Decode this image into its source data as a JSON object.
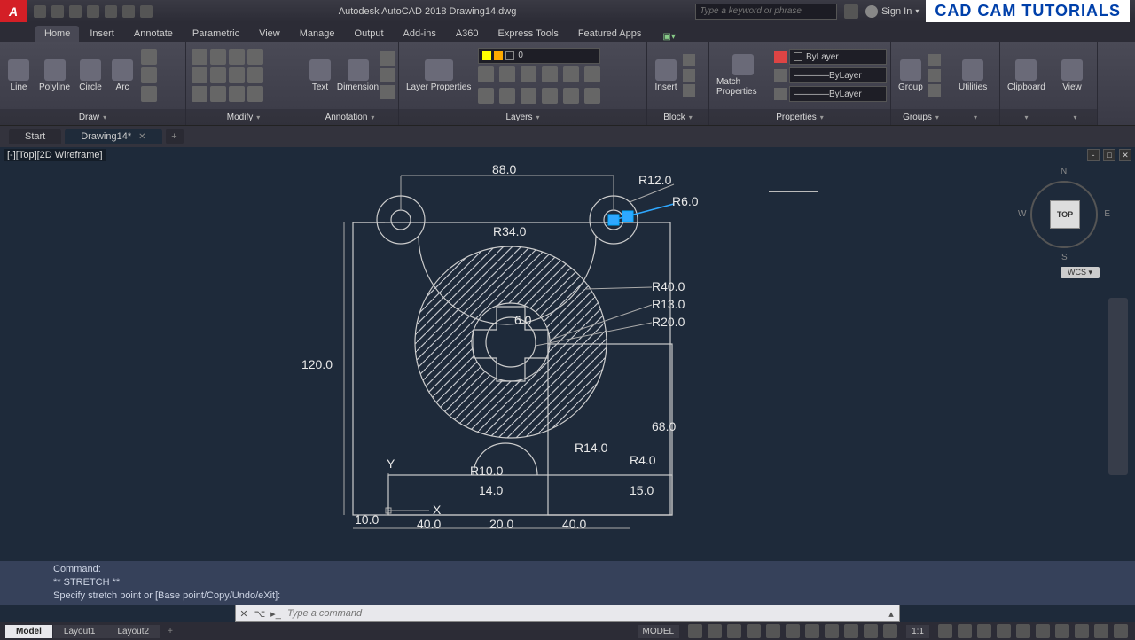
{
  "app": {
    "title": "Autodesk AutoCAD 2018   Drawing14.dwg",
    "search_placeholder": "Type a keyword or phrase",
    "signin": "Sign In",
    "brand": "CAD CAM TUTORIALS"
  },
  "tabs": [
    "Home",
    "Insert",
    "Annotate",
    "Parametric",
    "View",
    "Manage",
    "Output",
    "Add-ins",
    "A360",
    "Express Tools",
    "Featured Apps"
  ],
  "active_tab": "Home",
  "panels": {
    "draw": {
      "label": "Draw",
      "items": [
        "Line",
        "Polyline",
        "Circle",
        "Arc"
      ]
    },
    "modify": {
      "label": "Modify"
    },
    "annotation": {
      "label": "Annotation",
      "items": [
        "Text",
        "Dimension"
      ]
    },
    "layers": {
      "label": "Layers",
      "dropdown": "0",
      "btn": "Layer Properties"
    },
    "block": {
      "label": "Block",
      "items": [
        "Insert"
      ]
    },
    "properties": {
      "label": "Properties",
      "match": "Match Properties",
      "bylayer": "ByLayer"
    },
    "groups": {
      "label": "Groups",
      "btn": "Group"
    },
    "utilities": {
      "label": "Utilities"
    },
    "clipboard": {
      "label": "Clipboard"
    },
    "view": {
      "label": "View"
    }
  },
  "filetabs": {
    "start": "Start",
    "active": "Drawing14*"
  },
  "viewport": {
    "label": "[-][Top][2D Wireframe]",
    "viewcube": {
      "top": "TOP",
      "n": "N",
      "s": "S",
      "e": "E",
      "w": "W"
    },
    "wcs": "WCS ▾"
  },
  "dimensions": {
    "d88": "88.0",
    "r12": "R12.0",
    "r6": "R6.0",
    "r34": "R34.0",
    "r40": "R40.0",
    "r13": "R13.0",
    "r20": "R20.0",
    "d6": "6.0",
    "d120": "120.0",
    "d68": "68.0",
    "r14": "R14.0",
    "r4": "R4.0",
    "r10": "R10.0",
    "d14": "14.0",
    "d15": "15.0",
    "d10": "10.0",
    "d40a": "40.0",
    "d20": "20.0",
    "d40b": "40.0",
    "y": "Y",
    "x": "X"
  },
  "cmd": {
    "hist1": "Command:",
    "hist2": "** STRETCH **",
    "hist3": "Specify stretch point or [Base point/Copy/Undo/eXit]:",
    "placeholder": "Type a command",
    "prompt": "▸"
  },
  "layouts": [
    "Model",
    "Layout1",
    "Layout2"
  ],
  "status": {
    "model": "MODEL",
    "scale": "1:1"
  }
}
